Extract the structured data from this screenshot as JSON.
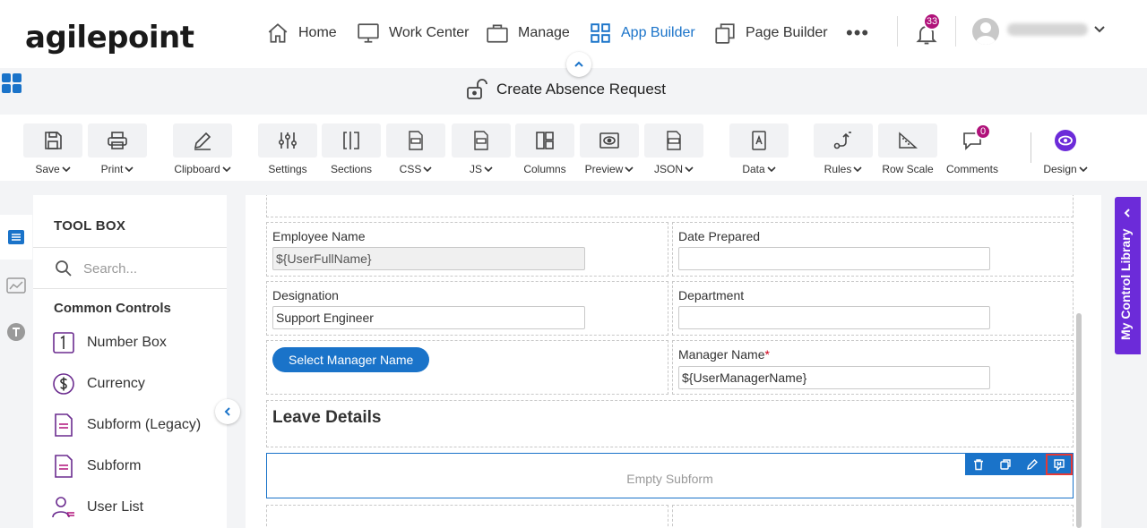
{
  "brand": {
    "logo_text": "agilepoint",
    "accent": "#1a73c9",
    "badge_color": "#b0127a",
    "library_color": "#6c2bd9"
  },
  "nav": {
    "items": [
      {
        "label": "Home",
        "icon": "home-icon"
      },
      {
        "label": "Work Center",
        "icon": "monitor-icon"
      },
      {
        "label": "Manage",
        "icon": "briefcase-icon"
      },
      {
        "label": "App Builder",
        "icon": "app-grid-icon",
        "active": true
      },
      {
        "label": "Page Builder",
        "icon": "copy-pages-icon"
      }
    ],
    "more": "•••",
    "notifications_count": "33"
  },
  "page": {
    "title": "Create Absence Request",
    "title_icon": "unlock-icon"
  },
  "toolbar": {
    "save": "Save",
    "print": "Print",
    "clipboard": "Clipboard",
    "settings": "Settings",
    "sections": "Sections",
    "css": "CSS",
    "js": "JS",
    "columns": "Columns",
    "preview": "Preview",
    "json": "JSON",
    "data": "Data",
    "rules": "Rules",
    "row_scale": "Row Scale",
    "comments": "Comments",
    "comments_count": "0",
    "design": "Design"
  },
  "toolbox": {
    "title": "TOOL BOX",
    "search_placeholder": "Search...",
    "section": "Common Controls",
    "controls": [
      "Number Box",
      "Currency",
      "Subform (Legacy)",
      "Subform",
      "User List"
    ]
  },
  "form": {
    "employee_name_label": "Employee Name",
    "employee_name_value": "${UserFullName}",
    "date_prepared_label": "Date Prepared",
    "date_prepared_value": "",
    "designation_label": "Designation",
    "designation_value": "Support Engineer",
    "department_label": "Department",
    "department_value": "",
    "select_manager_button": "Select Manager Name",
    "manager_name_label": "Manager Name",
    "required_mark": "*",
    "manager_name_value": "${UserManagerName}",
    "leave_details_title": "Leave Details",
    "empty_subform_text": "Empty Subform"
  },
  "control_library": {
    "label": "My Control Library"
  }
}
